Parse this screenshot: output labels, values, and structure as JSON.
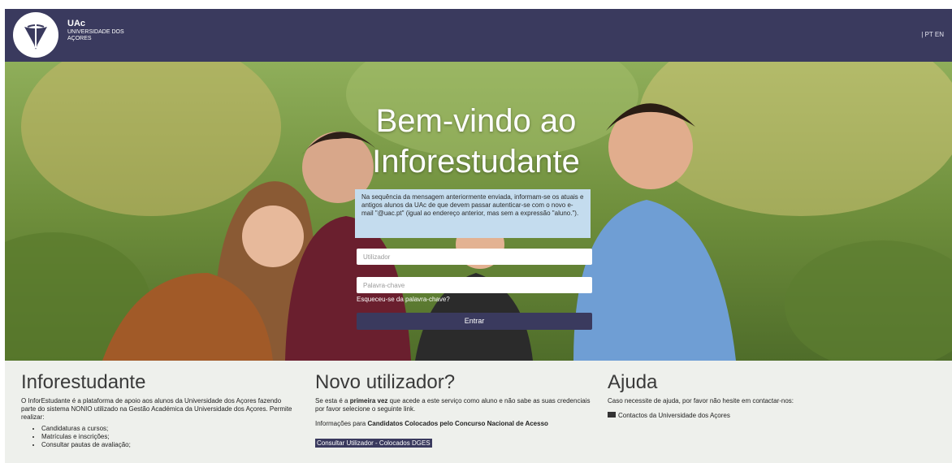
{
  "header": {
    "brand_name": "UAc",
    "brand_subtitle": "UNIVERSIDADE DOS AÇORES",
    "lang_separator": "|",
    "lang_pt": "PT",
    "lang_en": "EN"
  },
  "login": {
    "title_line1": "Bem-vindo ao",
    "title_line2": "Inforestudante",
    "notice": "Na sequência da mensagem anteriormente enviada, informam-se os atuais e antigos alunos da UAc de que devem passar autenticar-se com o novo e-mail \"@uac.pt\" (igual ao endereço anterior, mas sem a expressão \"aluno.\").",
    "username_placeholder": "Utilizador",
    "username_value": "",
    "password_placeholder": "Palavra-chave",
    "password_value": "",
    "forgot_link": "Esqueceu-se da palavra-chave?",
    "submit_label": "Entrar"
  },
  "info": {
    "title": "Inforestudante",
    "description": "O InforEstudante é a plataforma de apoio aos alunos da Universidade dos Açores fazendo parte do sistema NONIO utilizado na Gestão Académica da Universidade dos Açores. Permite realizar:",
    "items": [
      "Candidaturas a cursos;",
      "Matrículas e inscrições;",
      "Consultar pautas de avaliação;"
    ]
  },
  "new_user": {
    "title": "Novo utilizador?",
    "text_before": "Se esta é a ",
    "text_bold": "primeira vez",
    "text_after": " que acede a este serviço como aluno e não sabe as suas credenciais por favor selecione o seguinte link.",
    "info_prefix": "Informações para ",
    "info_bold": "Candidatos Colocados pelo Concurso Nacional de Acesso",
    "link_label": "Consultar Utilizador - Colocados DGES"
  },
  "help": {
    "title": "Ajuda",
    "text": "Caso necessite de ajuda, por favor não hesite em contactar-nos:",
    "contact_link": "Contactos da Universidade dos Açores"
  },
  "colors": {
    "brand": "#3a3a5e",
    "notice_bg": "#c4dcee"
  }
}
